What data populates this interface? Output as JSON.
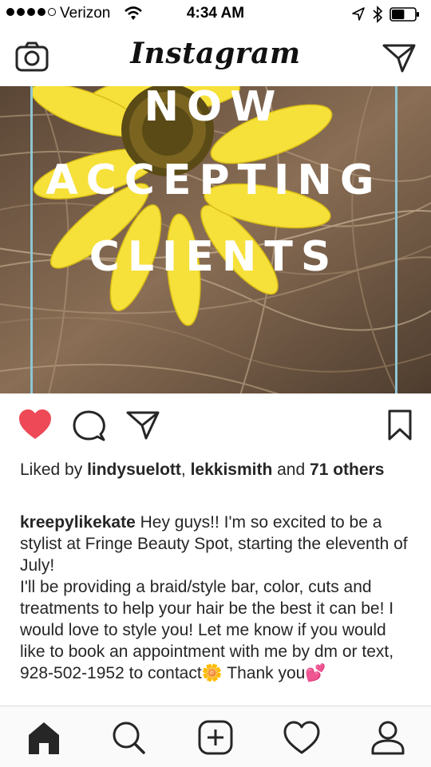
{
  "status_bar": {
    "carrier": "Verizon",
    "time": "4:34 AM",
    "signal_bars_filled": 4,
    "signal_bars_total": 5,
    "battery_level": 0.55
  },
  "header": {
    "brand": "Instagram",
    "left_icon": "camera-icon",
    "right_icon": "direct-message-icon"
  },
  "post": {
    "image_text": [
      "NOW",
      "ACCEPTING",
      "CLIENTS"
    ],
    "liked": true,
    "like_color": "#ed4956",
    "likes": {
      "prefix": "Liked by ",
      "user1": "lindysuelott",
      "separator": ", ",
      "user2": "lekkismith",
      "conjunction": " and ",
      "others": "71 others"
    },
    "caption": {
      "username": "kreepylikekate",
      "text1": " Hey guys!! I'm so excited to be a stylist at Fringe Beauty Spot, starting the eleventh of July!",
      "text2": "I'll be providing a braid/style bar, color, cuts and treatments to help your hair be the best it can be! I would love to style you! Let me know if you would like to book an appointment with me by dm or text, 928-502-1952 to contact🌼 Thank you💕"
    }
  },
  "tab_bar": {
    "tabs": [
      "home-icon",
      "search-icon",
      "new-post-icon",
      "activity-icon",
      "profile-icon"
    ],
    "active": "home-icon"
  }
}
